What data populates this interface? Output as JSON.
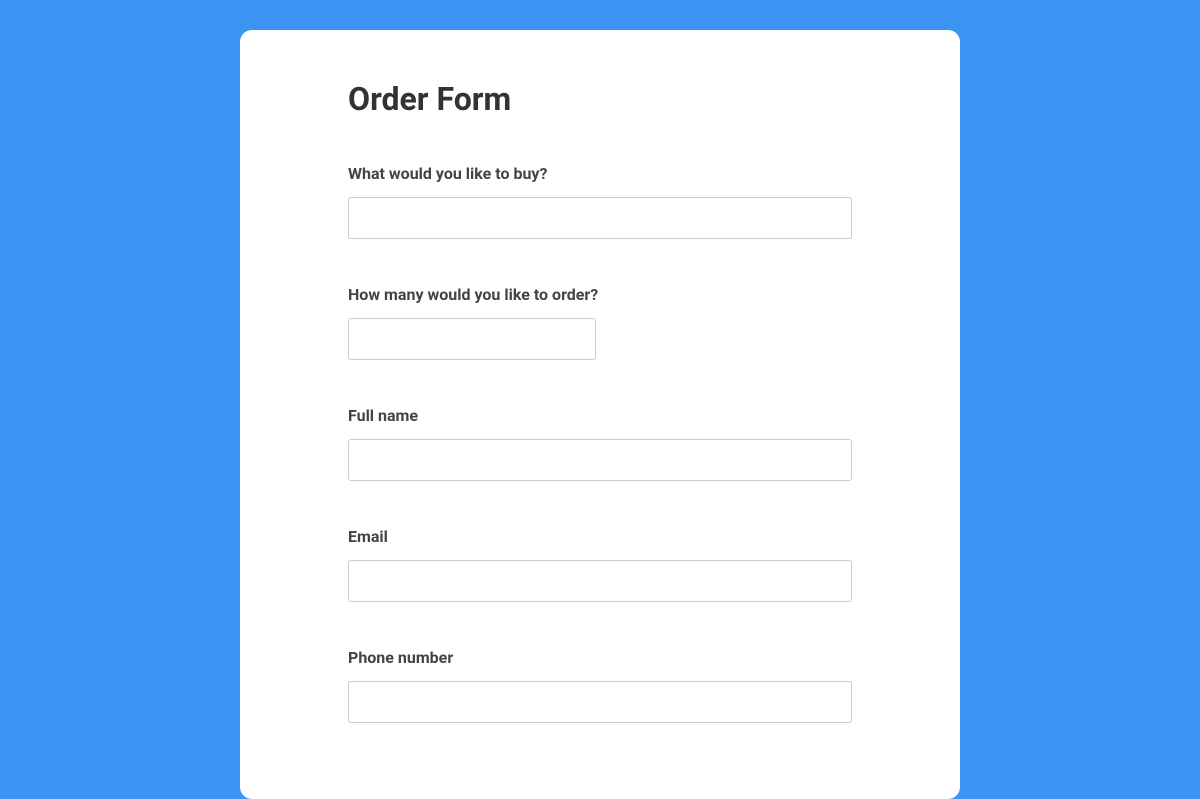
{
  "form": {
    "title": "Order Form",
    "fields": {
      "product": {
        "label": "What would you like to buy?",
        "value": ""
      },
      "quantity": {
        "label": "How many would you like to order?",
        "value": ""
      },
      "fullname": {
        "label": "Full name",
        "value": ""
      },
      "email": {
        "label": "Email",
        "value": ""
      },
      "phone": {
        "label": "Phone number",
        "value": ""
      }
    }
  }
}
